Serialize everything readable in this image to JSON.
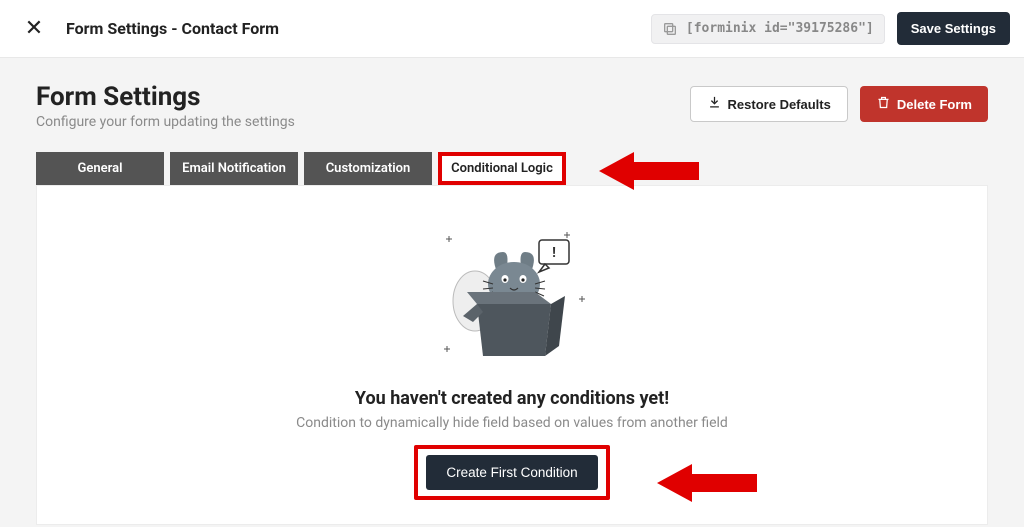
{
  "topbar": {
    "title": "Form Settings - Contact Form",
    "shortcode": "[forminix id=\"39175286\"]",
    "save_label": "Save Settings"
  },
  "header": {
    "title": "Form Settings",
    "subtitle": "Configure your form updating the settings",
    "restore_label": "Restore Defaults",
    "delete_label": "Delete Form"
  },
  "tabs": [
    {
      "label": "General"
    },
    {
      "label": "Email Notification"
    },
    {
      "label": "Customization"
    },
    {
      "label": "Conditional Logic",
      "active": true
    }
  ],
  "empty": {
    "title": "You haven't created any conditions yet!",
    "desc": "Condition to dynamically hide field based on values from another field",
    "cta": "Create First Condition"
  },
  "colors": {
    "accent_dark": "#222c38",
    "danger": "#c0342c",
    "annotation": "#e00000"
  }
}
